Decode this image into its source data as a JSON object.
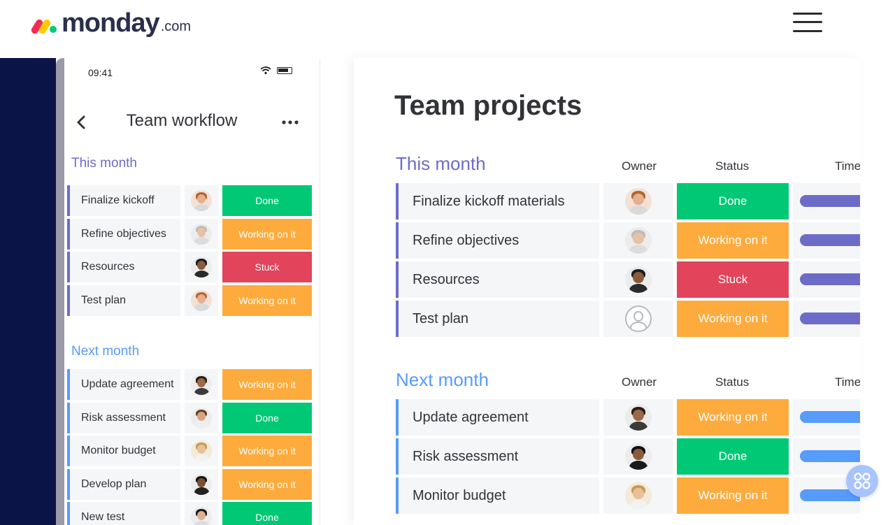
{
  "header": {
    "logo_word": "monday",
    "logo_tld": ".com",
    "menu_icon": "hamburger-menu-icon"
  },
  "colors": {
    "done": "#00c875",
    "working": "#fdab3d",
    "stuck": "#e2445c",
    "this_month": "#6c6cc8",
    "next_month": "#579bfc",
    "dark_band": "#0a1447"
  },
  "mobile": {
    "time": "09:41",
    "title": "Team workflow",
    "back_icon": "chevron-left-icon",
    "more_icon": "more-horizontal-icon",
    "groups": [
      {
        "title": "This month",
        "items": [
          {
            "name": "Finalize kickoff",
            "status": "Done",
            "kind": "done"
          },
          {
            "name": "Refine objectives",
            "status": "Working on it",
            "kind": "working"
          },
          {
            "name": "Resources",
            "status": "Stuck",
            "kind": "stuck"
          },
          {
            "name": "Test plan",
            "status": "Working on it",
            "kind": "working"
          }
        ]
      },
      {
        "title": "Next month",
        "items": [
          {
            "name": "Update agreement",
            "status": "Working on it",
            "kind": "working"
          },
          {
            "name": "Risk assessment",
            "status": "Done",
            "kind": "done"
          },
          {
            "name": "Monitor budget",
            "status": "Working on it",
            "kind": "working"
          },
          {
            "name": "Develop plan",
            "status": "Working on it",
            "kind": "working"
          },
          {
            "name": "New test",
            "status": "Done",
            "kind": "done"
          }
        ]
      }
    ]
  },
  "board": {
    "title": "Team projects",
    "columns": {
      "owner": "Owner",
      "status": "Status",
      "timeline": "Time"
    },
    "groups": [
      {
        "title": "This month",
        "items": [
          {
            "name": "Finalize kickoff materials",
            "status": "Done",
            "kind": "done"
          },
          {
            "name": "Refine objectives",
            "status": "Working on it",
            "kind": "working"
          },
          {
            "name": "Resources",
            "status": "Stuck",
            "kind": "stuck"
          },
          {
            "name": "Test plan",
            "status": "Working on it",
            "kind": "working"
          }
        ]
      },
      {
        "title": "Next month",
        "items": [
          {
            "name": "Update agreement",
            "status": "Working on it",
            "kind": "working"
          },
          {
            "name": "Risk assessment",
            "status": "Done",
            "kind": "done"
          },
          {
            "name": "Monitor budget",
            "status": "Working on it",
            "kind": "working"
          }
        ]
      }
    ]
  },
  "fab_icon": "apps-grid-icon"
}
